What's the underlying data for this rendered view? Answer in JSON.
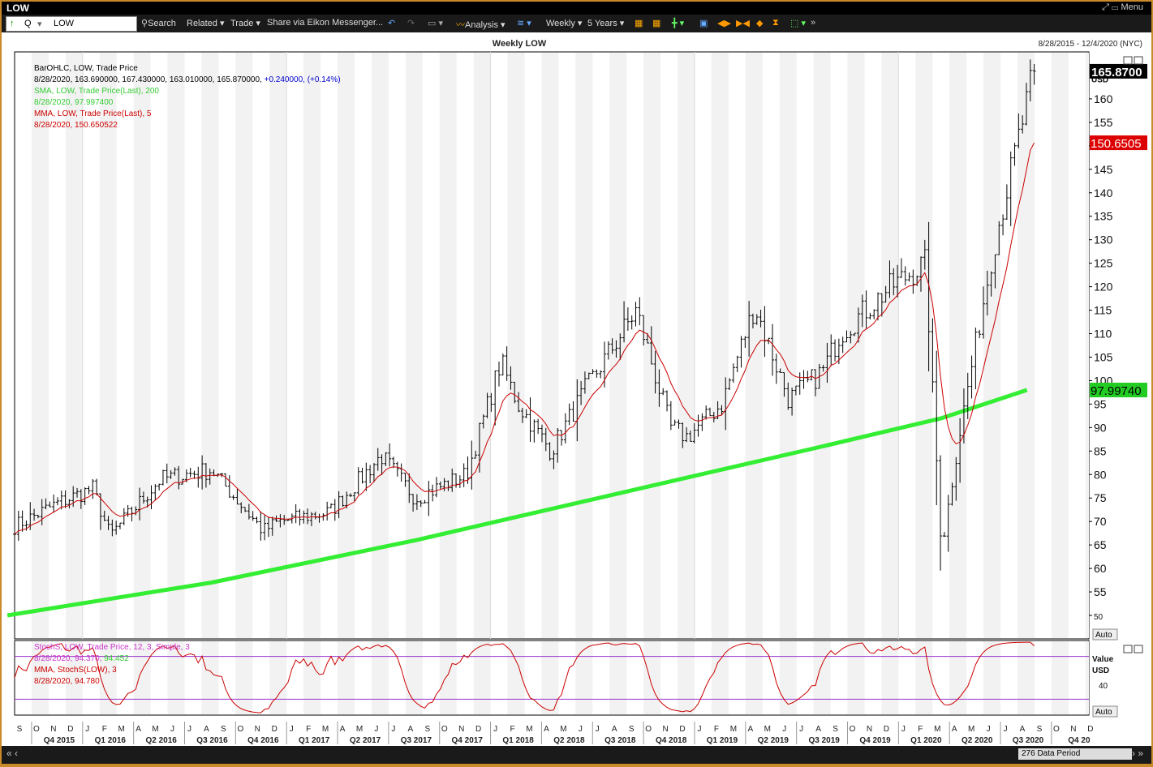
{
  "window": {
    "title": "LOW",
    "menu_label": "Menu"
  },
  "toolbar": {
    "ric_prefix": "Q",
    "ric_value": "LOW",
    "search": "Search",
    "related": "Related",
    "trade": "Trade",
    "share": "Share via Eikon Messenger...",
    "analysis": "Analysis",
    "interval": "Weekly",
    "range": "5 Years"
  },
  "header": {
    "title": "Weekly LOW",
    "date_range": "8/28/2015 - 12/4/2020 (NYC)"
  },
  "legend_main": [
    {
      "text": "BarOHLC, LOW, Trade Price",
      "color": "#000000"
    },
    {
      "text": "8/28/2020, 163.690000, 167.430000, 163.010000, 165.870000, ",
      "color": "#000000",
      "extra": "+0.240000, (+0.14%)",
      "extra_color": "#0000cc"
    },
    {
      "text": "SMA, LOW, Trade Price(Last),  200",
      "color": "#33cc33"
    },
    {
      "text": "8/28/2020, 97.997400",
      "color": "#33cc33"
    },
    {
      "text": "MMA, LOW, Trade Price(Last),  5",
      "color": "#cc0000"
    },
    {
      "text": "8/28/2020, 150.650522",
      "color": "#cc0000"
    }
  ],
  "legend_stoch": [
    {
      "text": "StochS, LOW, Trade Price,  12, 3, Simple,  3",
      "color": "#cc33cc"
    },
    {
      "text": "8/28/2020, 94.370, ",
      "color": "#cc33cc",
      "extra": "94.452",
      "extra_color": "#33cc33"
    },
    {
      "text": "MMA, StochS(LOW),  3",
      "color": "#cc0000"
    },
    {
      "text": "8/28/2020, 94.780",
      "color": "#cc0000"
    }
  ],
  "price_axis": {
    "unit": "USD",
    "ticks": [
      "50",
      "55",
      "60",
      "65",
      "70",
      "75",
      "80",
      "85",
      "90",
      "95",
      "100",
      "105",
      "110",
      "115",
      "120",
      "125",
      "130",
      "135",
      "140",
      "145",
      "150",
      "155",
      "160"
    ],
    "last_price": "165.8700",
    "mma_value": "150.6505",
    "sma_value": "97.99740",
    "auto_label": "Auto"
  },
  "stoch_axis": {
    "label": "Value",
    "unit": "USD",
    "ticks": [
      "40"
    ],
    "auto_label": "Auto"
  },
  "months": [
    "S",
    "O",
    "N",
    "D",
    "J",
    "F",
    "M",
    "A",
    "M",
    "J",
    "J",
    "A",
    "S",
    "O",
    "N",
    "D",
    "J",
    "F",
    "M",
    "A",
    "M",
    "J",
    "J",
    "A",
    "S",
    "O",
    "N",
    "D",
    "J",
    "F",
    "M",
    "A",
    "M",
    "J",
    "J",
    "A",
    "S",
    "O",
    "N",
    "D",
    "J",
    "F",
    "M",
    "A",
    "M",
    "J",
    "J",
    "A",
    "S",
    "O",
    "N",
    "D",
    "J",
    "F",
    "M",
    "A",
    "M",
    "J",
    "J",
    "A",
    "S",
    "O",
    "N",
    "D"
  ],
  "quarters": [
    "Q4 2015",
    "Q1 2016",
    "Q2 2016",
    "Q3 2016",
    "Q4 2016",
    "Q1 2017",
    "Q2 2017",
    "Q3 2017",
    "Q4 2017",
    "Q1 2018",
    "Q2 2018",
    "Q3 2018",
    "Q4 2018",
    "Q1 2019",
    "Q2 2019",
    "Q3 2019",
    "Q4 2019",
    "Q1 2020",
    "Q2 2020",
    "Q3 2020",
    "Q4 20"
  ],
  "data_period": "276 Data Period",
  "colors": {
    "bars": "#000000",
    "sma": "#33ee33",
    "mma": "#cc0000",
    "stoch": "#cc0000",
    "stoch_levels": "#9933cc",
    "last_price_bg": "#000000",
    "mma_bg": "#dd0000",
    "sma_bg": "#22cc22"
  },
  "chart_data": {
    "type": "ohlc",
    "interval": "weekly",
    "x_range": [
      "2015-08-28",
      "2020-12-04"
    ],
    "ylim": [
      45,
      170
    ],
    "last_bar": {
      "date": "2020-08-28",
      "open": 163.69,
      "high": 167.43,
      "low": 163.01,
      "close": 165.87,
      "change": 0.24,
      "change_pct": 0.14
    },
    "close_approx": {
      "x": [
        "2015-08",
        "2015-11",
        "2016-01",
        "2016-02",
        "2016-05",
        "2016-08",
        "2016-11",
        "2016-12",
        "2017-03",
        "2017-06",
        "2017-08",
        "2017-11",
        "2018-01",
        "2018-02",
        "2018-04",
        "2018-06",
        "2018-09",
        "2018-11",
        "2018-12",
        "2019-02",
        "2019-04",
        "2019-06",
        "2019-08",
        "2019-09",
        "2019-12",
        "2020-02",
        "2020-03",
        "2020-04",
        "2020-06",
        "2020-08"
      ],
      "values": [
        69,
        74,
        77,
        67,
        79,
        81,
        68,
        70,
        72,
        84,
        75,
        80,
        104,
        95,
        85,
        98,
        115,
        90,
        88,
        95,
        116,
        96,
        102,
        110,
        120,
        125,
        64,
        88,
        128,
        165.87
      ]
    },
    "sma": {
      "name": "SMA 200",
      "x": [
        "2015-08",
        "2016-08",
        "2017-08",
        "2018-08",
        "2019-08",
        "2020-03",
        "2020-08"
      ],
      "values": [
        50,
        57,
        66,
        76,
        86,
        92,
        98.0
      ]
    },
    "mma": {
      "name": "MMA 5",
      "last": 150.65
    },
    "stoch": {
      "ylim": [
        0,
        100
      ],
      "levels": [
        20,
        80
      ],
      "last_k": 94.37,
      "last_d": 94.452,
      "mma_last": 94.78
    }
  }
}
